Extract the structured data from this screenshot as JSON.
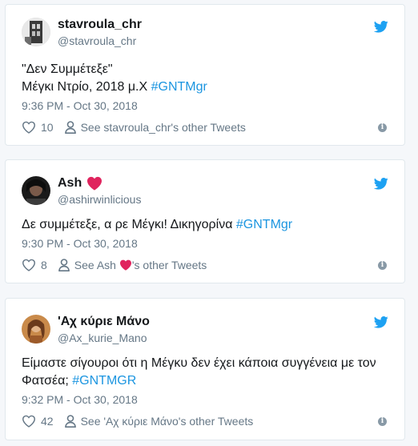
{
  "colors": {
    "link": "#1b95e0",
    "heart": "#e0245e",
    "muted": "#657786",
    "twitter_blue": "#1da1f2"
  },
  "tweets": [
    {
      "name": "stavroula_chr",
      "handle": "@stavroula_chr",
      "line1": "\"Δεν Συμμέτεξε\"",
      "line2_text": "Μέγκι Ντρίο, 2018 μ.Χ ",
      "line2_tag": "#GNTMgr",
      "time": "9:36 PM - Oct 30, 2018",
      "likes": "10",
      "see_other": "See stavroula_chr's other Tweets",
      "icons": {
        "like": "heart-outline-icon",
        "profile": "person-icon",
        "brand": "twitter-bird-icon",
        "info": "info-icon"
      }
    },
    {
      "name": "Ash",
      "handle": "@ashirwinlicious",
      "line1_text": "Δε συμμέτεξε, α ρε Μέγκι! Δικηγορίνα ",
      "line1_tag": "#GNTMgr",
      "time": "9:30 PM - Oct 30, 2018",
      "likes": "8",
      "see_prefix": "See Ash ",
      "see_suffix": "'s other Tweets",
      "icons": {
        "name_emoji": "red-heart-icon",
        "like": "heart-outline-icon",
        "profile": "person-icon",
        "brand": "twitter-bird-icon",
        "info": "info-icon"
      }
    },
    {
      "name": "'Αχ κύριε Μάνο",
      "handle": "@Ax_kurie_Mano",
      "line1": "Είμαστε σίγουροι ότι η Μέγκυ δεν έχει κάποια συγγένεια με τον",
      "line2_text": "Φατσέα; ",
      "line2_tag": "#GNTMGR",
      "time": "9:32 PM - Oct 30, 2018",
      "likes": "42",
      "see_other": "See 'Αχ κύριε Μάνο's other Tweets",
      "icons": {
        "like": "heart-outline-icon",
        "profile": "person-icon",
        "brand": "twitter-bird-icon",
        "info": "info-icon"
      }
    }
  ]
}
